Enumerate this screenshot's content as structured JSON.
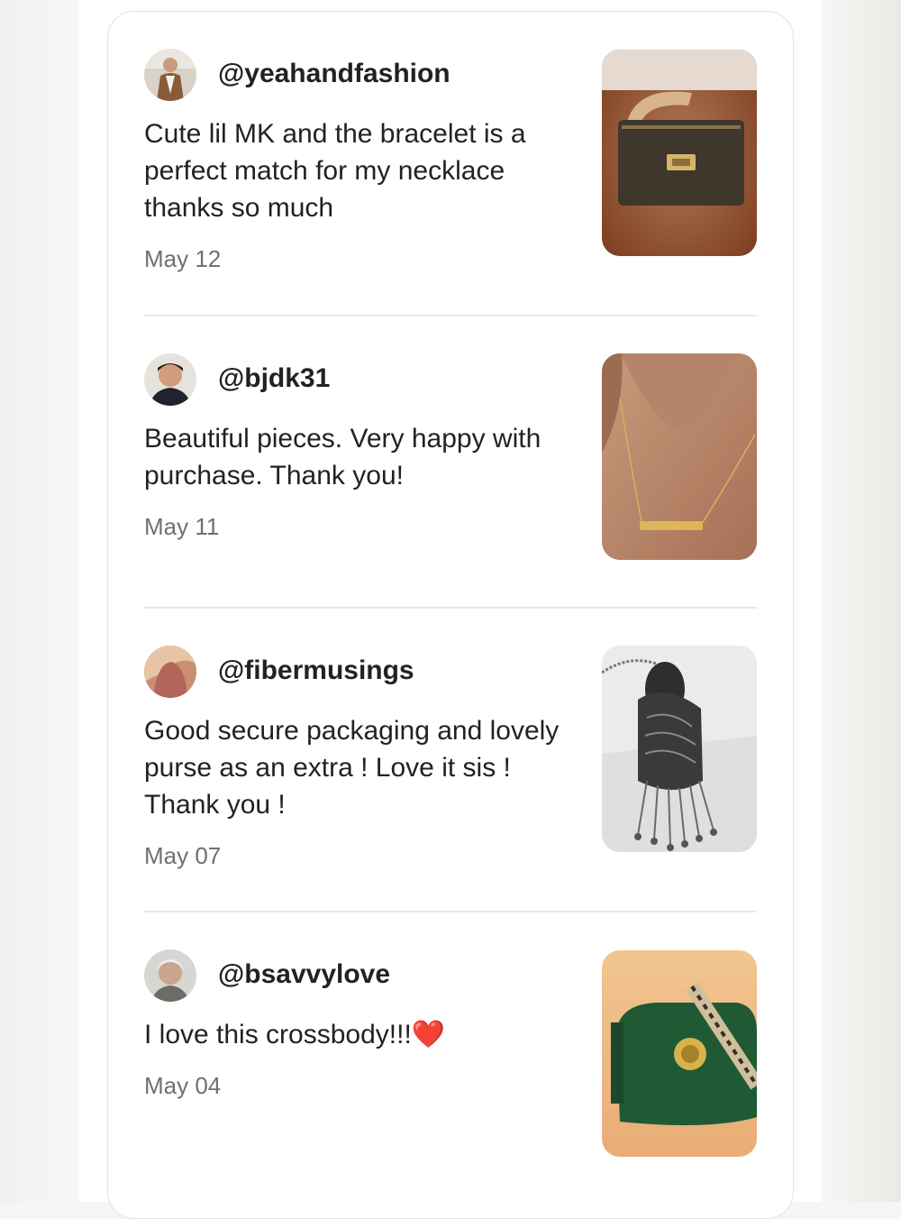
{
  "reviews": [
    {
      "username": "@yeahandfashion",
      "text": "Cute lil MK and the bracelet is a perfect match for my necklace thanks so much",
      "date": "May 12",
      "avatar_icon": "user-avatar",
      "photo_subject": "brown-monogram-wristlet-photo"
    },
    {
      "username": "@bjdk31",
      "text": "Beautiful pieces. Very happy with purchase. Thank you!",
      "date": "May 11",
      "avatar_icon": "user-avatar",
      "photo_subject": "gold-bar-necklace-photo"
    },
    {
      "username": "@fibermusings",
      "text": "Good secure packaging and lovely purse as an extra ! Love it sis ! Thank you !",
      "date": "May 07",
      "avatar_icon": "user-avatar",
      "photo_subject": "peacock-pendant-necklace-photo"
    },
    {
      "username": "@bsavvylove",
      "text": "I love this crossbody!!!",
      "emoji": "❤️",
      "date": "May 04",
      "avatar_icon": "user-avatar",
      "photo_subject": "green-crossbody-bag-photo"
    }
  ],
  "colors": {
    "text": "#222222",
    "date": "#707070",
    "divider": "#e8e8e8",
    "card_border": "#e3e3e3"
  }
}
